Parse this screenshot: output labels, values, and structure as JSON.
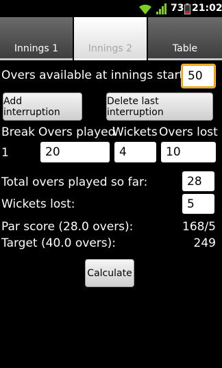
{
  "status_bar": {
    "battery_percent": "73",
    "time": "21:02",
    "icons": [
      "wifi-icon",
      "signal-icon",
      "battery-icon"
    ]
  },
  "tabs": [
    {
      "label": "Innings 1",
      "selected": false
    },
    {
      "label": "Innings 2",
      "selected": true
    },
    {
      "label": "Table",
      "selected": false
    }
  ],
  "form": {
    "overs_available_label": "Overs available at innings start:",
    "overs_available_value": "50",
    "add_interruption_label": "Add interruption",
    "delete_interruption_label": "Delete last interruption",
    "columns": [
      "Break",
      "Overs played",
      "Wickets",
      "Overs lost"
    ],
    "interruptions": [
      {
        "break": "1",
        "overs_played": "20",
        "wickets": "4",
        "overs_lost": "10"
      }
    ],
    "total_overs_label": "Total overs played so far:",
    "total_overs_value": "28",
    "wickets_lost_label": "Wickets lost:",
    "wickets_lost_value": "5",
    "par_score_label": "Par score (28.0 overs):",
    "par_score_value": "168/5",
    "target_label": "Target (40.0 overs):",
    "target_value": "249",
    "calculate_label": "Calculate"
  },
  "colors": {
    "focus_border": "#f4a000",
    "background": "#000000",
    "tab_active": "#ffffff",
    "tab_inactive": "#4a4a4a",
    "wifi": "#7ccf1c",
    "battery_low": "#d81c1c"
  }
}
